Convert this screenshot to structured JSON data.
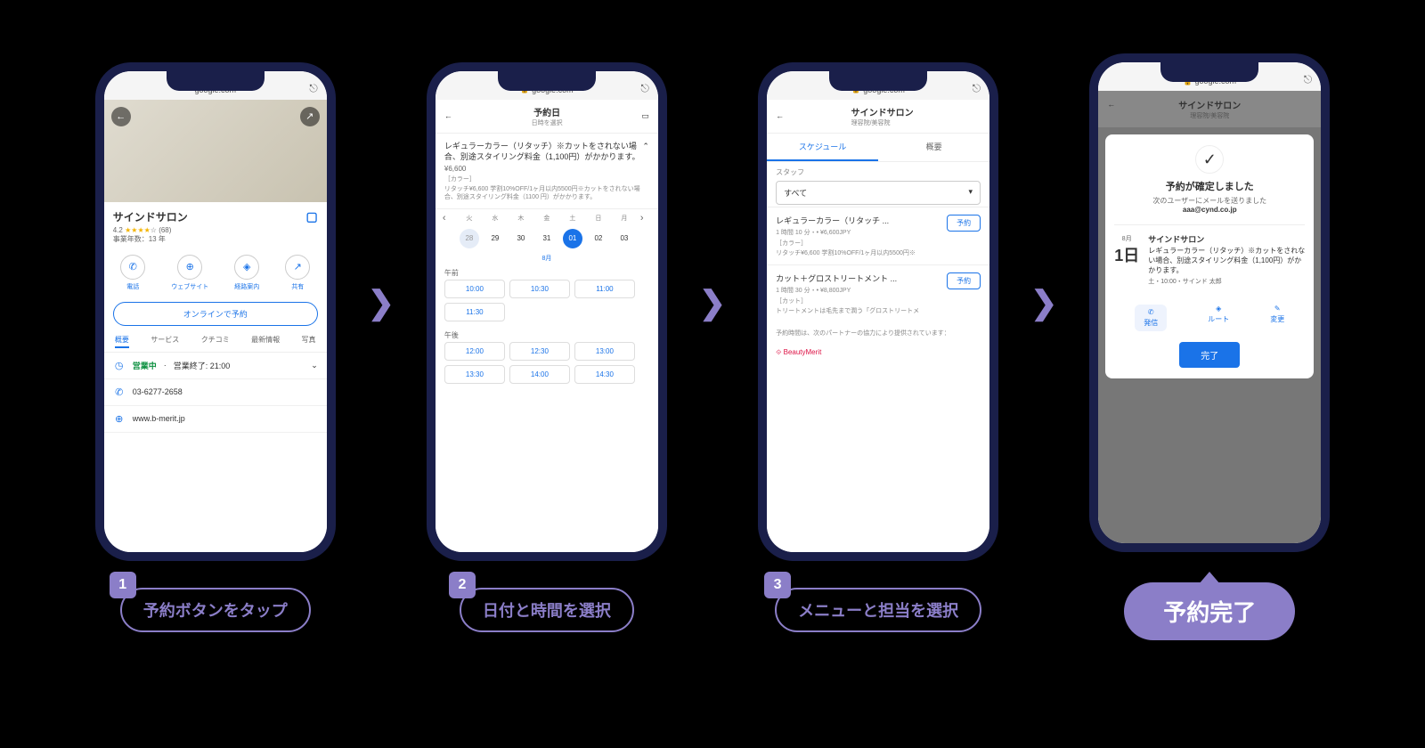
{
  "url": "google.com",
  "steps": {
    "s1": {
      "num": "1",
      "label": "予約ボタンをタップ"
    },
    "s2": {
      "num": "2",
      "label": "日付と時間を選択"
    },
    "s3": {
      "num": "3",
      "label": "メニューと担当を選択"
    },
    "final": "予約完了"
  },
  "screen1": {
    "biz_name": "サインドサロン",
    "rating": "4.2",
    "review_count": "(68)",
    "years": "事業年数：13 年",
    "actions": {
      "call": "電話",
      "web": "ウェブサイト",
      "route": "経路案内",
      "share": "共有"
    },
    "reserve": "オンラインで予約",
    "tabs": {
      "overview": "概要",
      "service": "サービス",
      "reviews": "クチコミ",
      "updates": "最新情報",
      "photos": "写真"
    },
    "hours_open": "営業中",
    "hours_close": "営業終了: 21:00",
    "phone": "03-6277-2658",
    "website": "www.b-merit.jp"
  },
  "screen2": {
    "title": "予約日",
    "subtitle": "日時を選択",
    "service_name": "レギュラーカラー（リタッチ）※カットをされない場合、別途スタイリング料金（1,100円）がかかります。",
    "price": "¥6,600",
    "category": "［カラー］",
    "desc": "リタッチ¥6,600 学割10%OFF/1ヶ月以内5500円※カットをされない場合、別途スタイリング料金（1100 円）がかかります。",
    "days": [
      "火",
      "水",
      "木",
      "金",
      "土",
      "日",
      "月"
    ],
    "dates": [
      "28",
      "29",
      "30",
      "31",
      "01",
      "02",
      "03"
    ],
    "month": "8月",
    "am_label": "午前",
    "pm_label": "午後",
    "am_slots": [
      "10:00",
      "10:30",
      "11:00",
      "11:30"
    ],
    "pm_slots": [
      "12:00",
      "12:30",
      "13:00",
      "13:30",
      "14:00",
      "14:30"
    ]
  },
  "screen3": {
    "title": "サインドサロン",
    "subtitle": "理容院/美容院",
    "tabs": {
      "schedule": "スケジュール",
      "overview": "概要"
    },
    "staff_label": "スタッフ",
    "staff_value": "すべて",
    "menu1": {
      "name": "レギュラーカラー（リタッチ ...",
      "meta": "1 時間 10 分・• ¥6,600JPY",
      "cat": "［カラー］",
      "desc": "リタッチ¥6,600 学割10%OFF/1ヶ月以内5500円※"
    },
    "menu2": {
      "name": "カット＋グロストリートメント ...",
      "meta": "1 時間 30 分・• ¥8,800JPY",
      "cat": "［カット］",
      "desc": "トリートメントは毛先まで潤う「グロストリートメ"
    },
    "btn": "予約",
    "partner_note": "予約時間は、次のパートナーの協力により提供されています：",
    "partner_name": "BeautyMerit"
  },
  "screen4": {
    "hdr_title": "サインドサロン",
    "hdr_sub": "理容院/美容院",
    "title": "予約が確定しました",
    "sub": "次のユーザーにメールを送りました",
    "email": "aaa@cynd.co.jp",
    "month": "8月",
    "day": "1日",
    "biz": "サインドサロン",
    "service": "レギュラーカラー（リタッチ）※カットをされない場合、別途スタイリング料金（1,100円）がかかります。",
    "time": "土・10:00・サインド 太郎",
    "actions": {
      "call": "発信",
      "route": "ルート",
      "change": "変更"
    },
    "done": "完了"
  }
}
